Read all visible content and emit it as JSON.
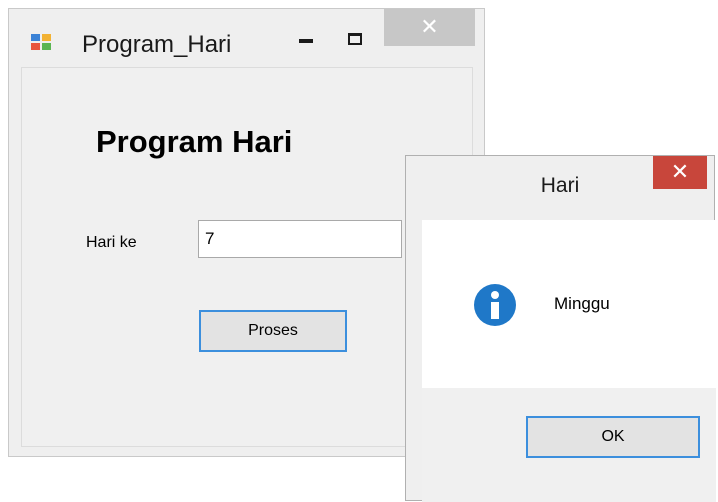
{
  "main_window": {
    "title": "Program_Hari",
    "minimize_glyph": "",
    "close_glyph": "✕",
    "heading": "Program Hari",
    "day_label": "Hari ke",
    "day_input_value": "7",
    "process_button_label": "Proses"
  },
  "message_box": {
    "title": "Hari",
    "close_glyph": "✕",
    "message": "Minggu",
    "ok_button_label": "OK",
    "icon": "info-icon"
  },
  "colors": {
    "accent_border": "#3c8fdd",
    "close_red": "#c8463b",
    "info_blue": "#1f78c8"
  }
}
